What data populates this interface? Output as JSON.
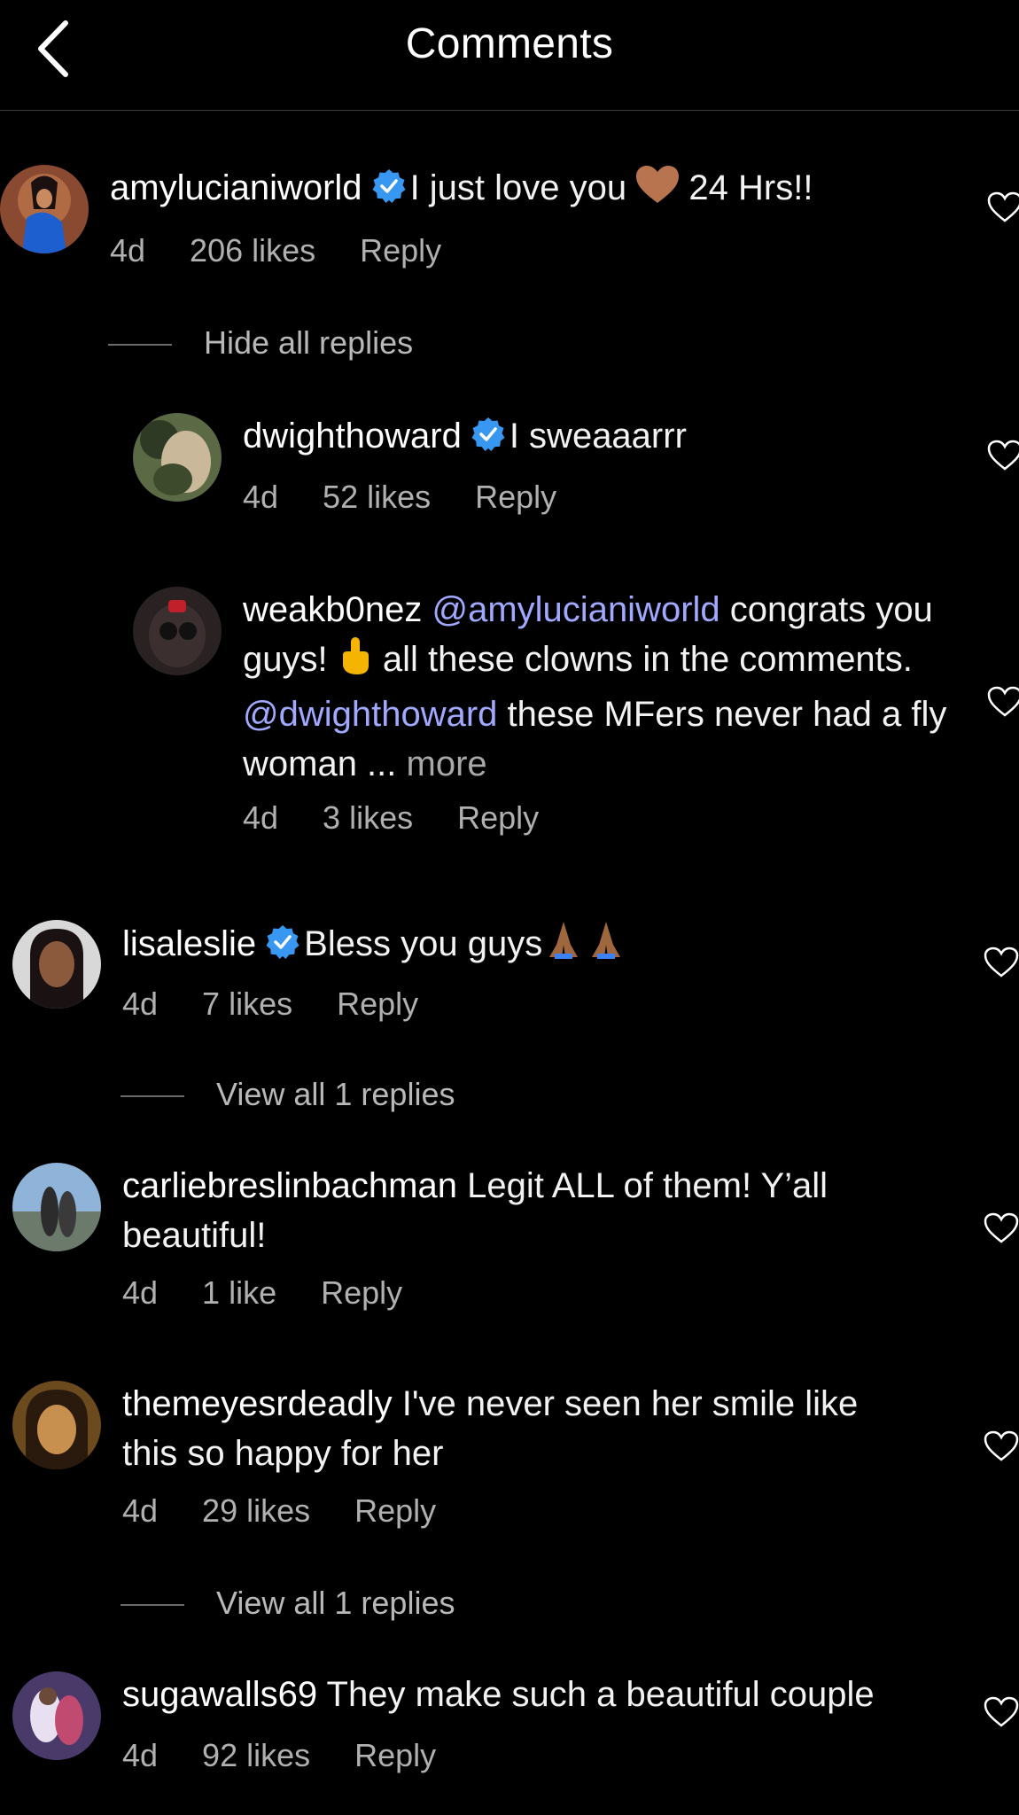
{
  "header": {
    "title": "Comments"
  },
  "comments": [
    {
      "username": "amylucianiworld",
      "text_before": "I just love you",
      "text_after": "24 Hrs!!",
      "time": "4d",
      "likes": "206 likes",
      "reply": "Reply"
    },
    {
      "username": "dwighthoward",
      "text": "I sweaaarrr",
      "time": "4d",
      "likes": "52 likes",
      "reply": "Reply"
    },
    {
      "username": "weakb0nez",
      "mention1": "@amylucianiworld",
      "text1": "congrats you guys!",
      "text2": "all these clowns in the comments.",
      "mention2": "@dwighthoward",
      "text3": "these MFers never had a fly woman ...",
      "more": "more",
      "time": "4d",
      "likes": "3 likes",
      "reply": "Reply"
    },
    {
      "username": "lisaleslie",
      "text": "Bless you guys",
      "time": "4d",
      "likes": "7 likes",
      "reply": "Reply"
    },
    {
      "username": "carliebreslinbachman",
      "text": "Legit ALL of them! Y’all beautiful!",
      "time": "4d",
      "likes": "1 like",
      "reply": "Reply"
    },
    {
      "username": "themeyesrdeadly",
      "text": "I've never seen her smile like this so happy for her",
      "time": "4d",
      "likes": "29 likes",
      "reply": "Reply"
    },
    {
      "username": "sugawalls69",
      "text": "They make such a beautiful couple",
      "time": "4d",
      "likes": "92 likes",
      "reply": "Reply"
    }
  ],
  "threads": {
    "hide_all": "Hide all replies",
    "view_1": "View all 1 replies",
    "view_2": "View all 1 replies"
  },
  "colors": {
    "background": "#000000",
    "mention": "#a0a8ff",
    "verified": "#3897f0",
    "muted": "#b0b0b0"
  },
  "icons": [
    "back-chevron-icon",
    "verified-badge-icon",
    "heart-outline-icon",
    "brown-heart-emoji",
    "middle-finger-emoji",
    "praying-hands-emoji"
  ]
}
